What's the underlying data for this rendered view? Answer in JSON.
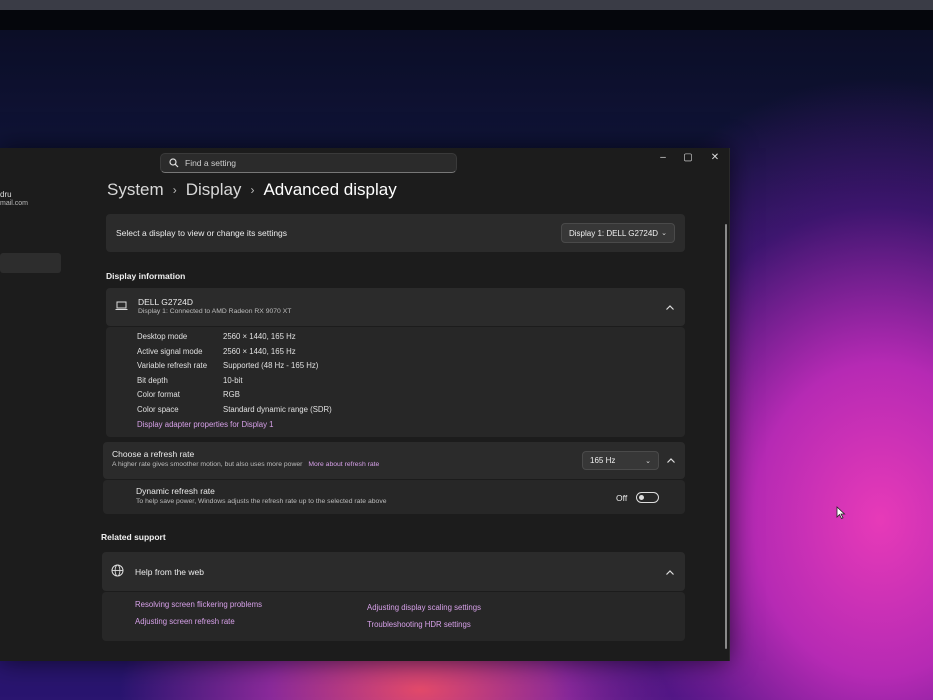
{
  "search": {
    "placeholder": "Find a setting"
  },
  "window_controls": {
    "minimize": "–",
    "maximize": "▢",
    "close": "✕"
  },
  "account": {
    "name_fragment": "dru",
    "email_fragment": "mail.com"
  },
  "breadcrumb": {
    "items": [
      "System",
      "Display",
      "Advanced display"
    ]
  },
  "select_display": {
    "label": "Select a display to view or change its settings",
    "value": "Display 1: DELL G2724D"
  },
  "display_information": {
    "section_title": "Display information",
    "monitor_name": "DELL G2724D",
    "connection": "Display 1: Connected to AMD Radeon RX 9070 XT",
    "rows": [
      {
        "label": "Desktop mode",
        "value": "2560 × 1440, 165 Hz"
      },
      {
        "label": "Active signal mode",
        "value": "2560 × 1440, 165 Hz"
      },
      {
        "label": "Variable refresh rate",
        "value": "Supported (48 Hz - 165 Hz)"
      },
      {
        "label": "Bit depth",
        "value": "10-bit"
      },
      {
        "label": "Color format",
        "value": "RGB"
      },
      {
        "label": "Color space",
        "value": "Standard dynamic range (SDR)"
      }
    ],
    "adapter_link": "Display adapter properties for Display 1"
  },
  "refresh_rate": {
    "title": "Choose a refresh rate",
    "description": "A higher rate gives smoother motion, but also uses more power",
    "more_link": "More about refresh rate",
    "value": "165 Hz"
  },
  "dynamic_refresh": {
    "title": "Dynamic refresh rate",
    "description": "To help save power, Windows adjusts the refresh rate up to the selected rate above",
    "state_label": "Off",
    "enabled": false
  },
  "related_support": {
    "section_title": "Related support",
    "help_title": "Help from the web",
    "links": [
      "Resolving screen flickering problems",
      "Adjusting display scaling settings",
      "Adjusting screen refresh rate",
      "Troubleshooting HDR settings"
    ]
  },
  "colors": {
    "accent_link": "#d6a0e8",
    "window_bg": "#1c1c1c",
    "card_bg": "#2b2b2b"
  }
}
